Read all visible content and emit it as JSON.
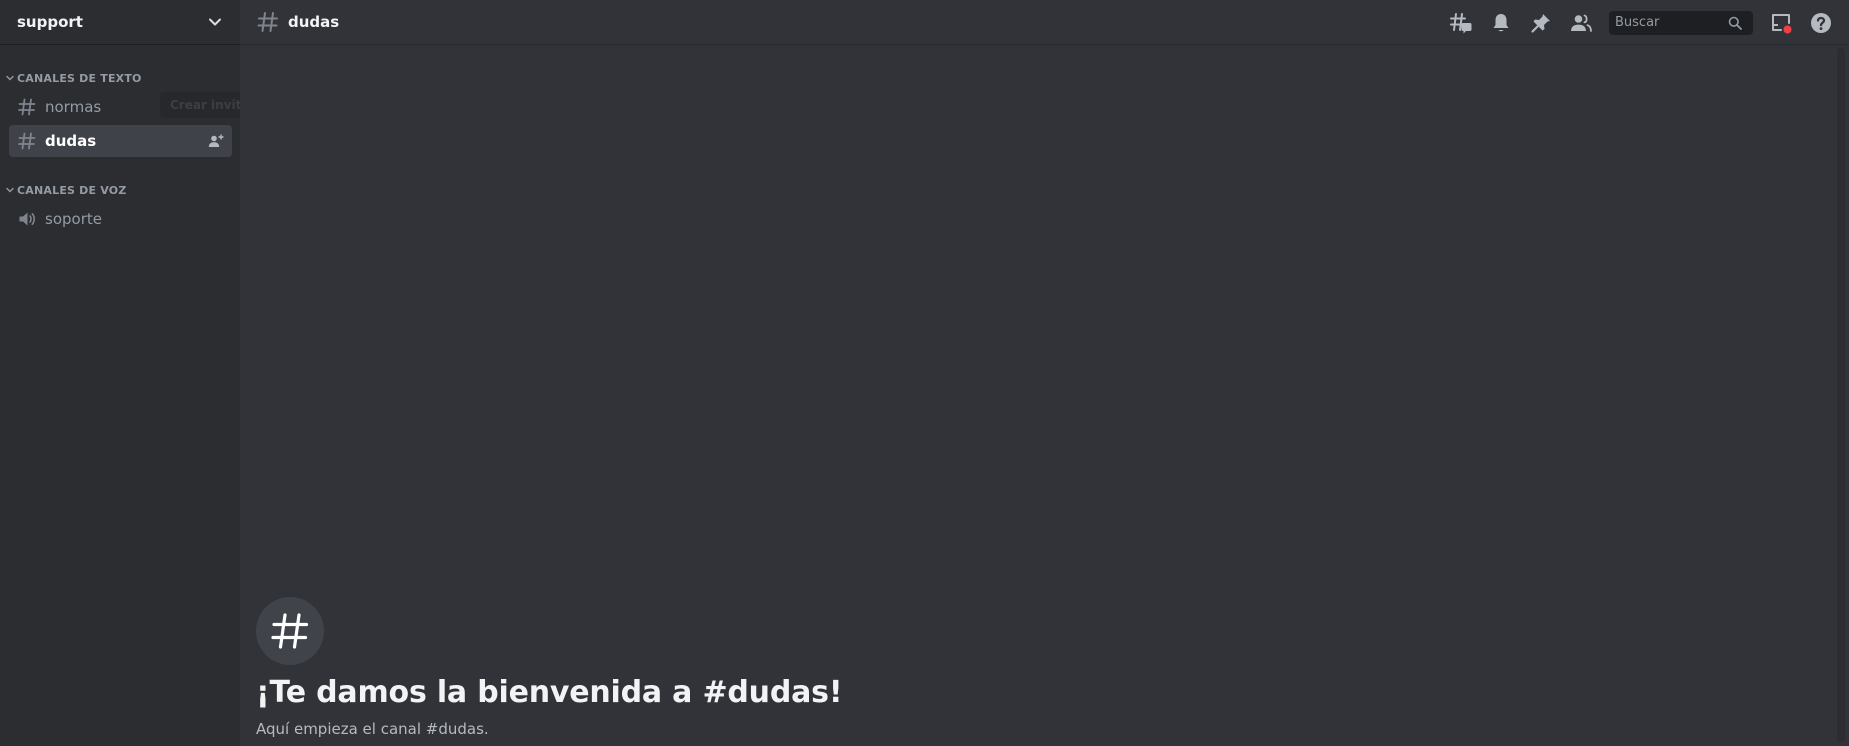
{
  "server": {
    "name": "support"
  },
  "categories": [
    {
      "label": "CANALES DE TEXTO",
      "channels": [
        {
          "name": "normas",
          "icon": "hash-icon",
          "active": false
        },
        {
          "name": "dudas",
          "icon": "hash-icon",
          "active": true
        }
      ]
    },
    {
      "label": "CANALES DE VOZ",
      "channels": [
        {
          "name": "soporte",
          "icon": "speaker-icon",
          "active": false
        }
      ]
    }
  ],
  "tooltip": {
    "text": "Crear invitación"
  },
  "header": {
    "channel_name": "dudas"
  },
  "toolbar": {
    "icons": [
      "threads-icon",
      "bell-icon",
      "pin-icon",
      "members-icon",
      "inbox-icon",
      "help-icon"
    ],
    "search_placeholder": "Buscar"
  },
  "welcome": {
    "title": "¡Te damos la bienvenida a #dudas!",
    "subtitle": "Aquí empieza el canal #dudas."
  },
  "colors": {
    "sidebar_bg": "#2b2d31",
    "main_bg": "#313338",
    "active_channel_bg": "#404249",
    "text_muted": "#949ba4",
    "text_bright": "#f2f3f5",
    "notification_dot": "#f23f43"
  }
}
